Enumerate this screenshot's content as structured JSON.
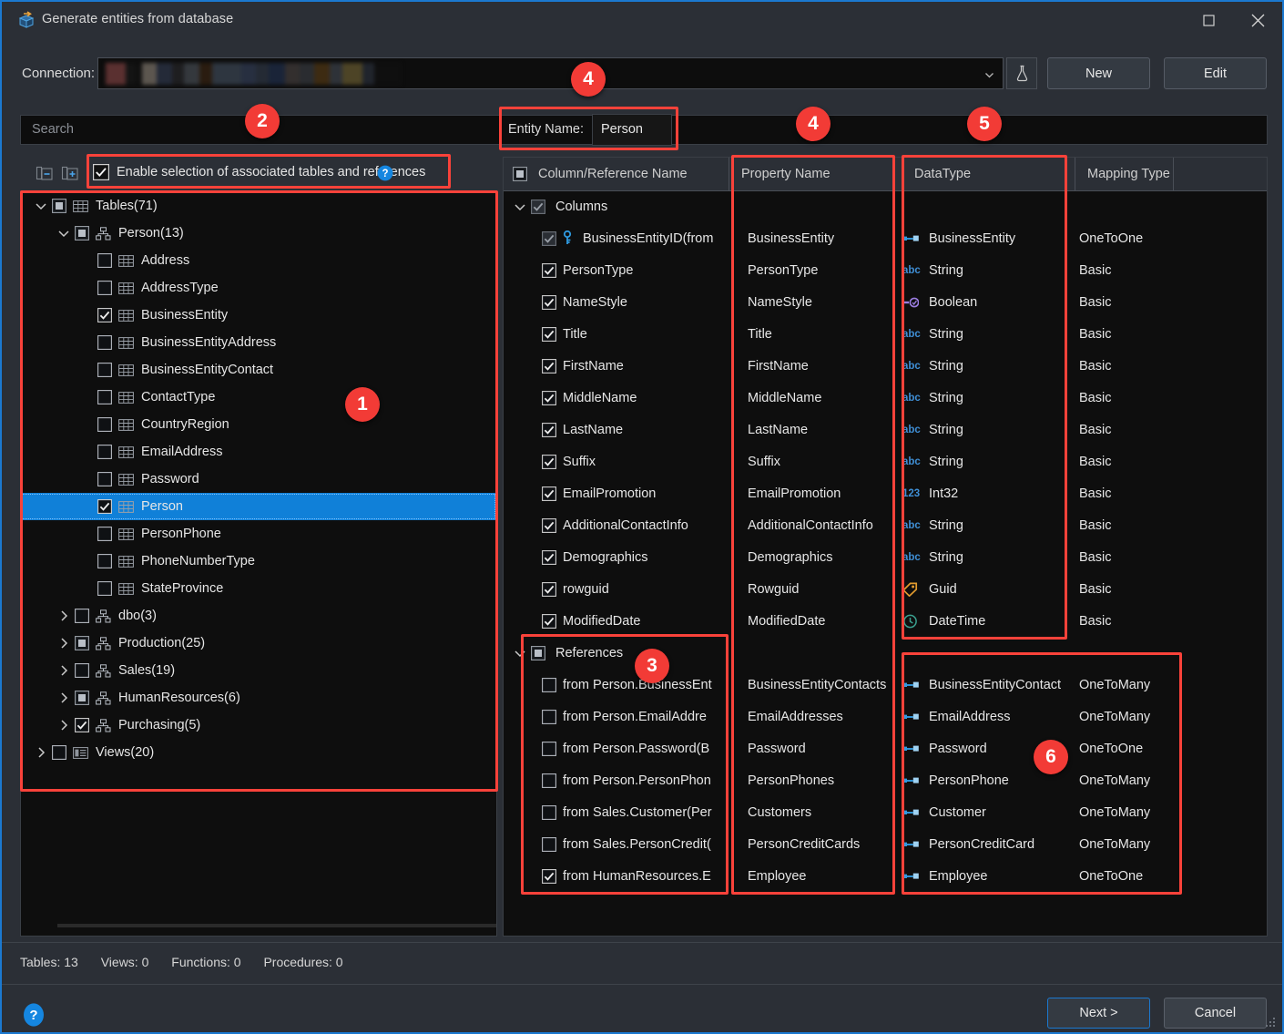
{
  "window": {
    "title": "Generate entities from database",
    "title_icon": "generate-entities-icon",
    "maximize_icon": "maximize-icon",
    "close_icon": "close-icon",
    "accent": "#1b79d0"
  },
  "connection": {
    "label": "Connection:",
    "value": "",
    "dropdown_icon": "chevron-down-icon",
    "test_icon": "flask-icon",
    "new_label": "New",
    "edit_label": "Edit"
  },
  "search": {
    "placeholder": "Search",
    "value": ""
  },
  "entity": {
    "label": "Entity Name:",
    "value": "Person"
  },
  "left_toolbar": {
    "collapse_icon": "collapse-all-icon",
    "expand_icon": "expand-all-icon",
    "assoc_label": "Enable selection of associated tables and references",
    "assoc_checked": true,
    "help_icon": "help-icon"
  },
  "tree": [
    {
      "label": "Tables(71)",
      "indent": 0,
      "chevron": "down",
      "check": "partial",
      "icon": "table-icon",
      "selected": false
    },
    {
      "label": "Person(13)",
      "indent": 1,
      "chevron": "down",
      "check": "partial",
      "icon": "schema-icon",
      "selected": false
    },
    {
      "label": "Address",
      "indent": 2,
      "chevron": "none",
      "check": "off",
      "icon": "table-icon",
      "selected": false
    },
    {
      "label": "AddressType",
      "indent": 2,
      "chevron": "none",
      "check": "off",
      "icon": "table-icon",
      "selected": false
    },
    {
      "label": "BusinessEntity",
      "indent": 2,
      "chevron": "none",
      "check": "on",
      "icon": "table-icon",
      "selected": false
    },
    {
      "label": "BusinessEntityAddress",
      "indent": 2,
      "chevron": "none",
      "check": "off",
      "icon": "table-icon",
      "selected": false
    },
    {
      "label": "BusinessEntityContact",
      "indent": 2,
      "chevron": "none",
      "check": "off",
      "icon": "table-icon",
      "selected": false
    },
    {
      "label": "ContactType",
      "indent": 2,
      "chevron": "none",
      "check": "off",
      "icon": "table-icon",
      "selected": false
    },
    {
      "label": "CountryRegion",
      "indent": 2,
      "chevron": "none",
      "check": "off",
      "icon": "table-icon",
      "selected": false
    },
    {
      "label": "EmailAddress",
      "indent": 2,
      "chevron": "none",
      "check": "off",
      "icon": "table-icon",
      "selected": false
    },
    {
      "label": "Password",
      "indent": 2,
      "chevron": "none",
      "check": "off",
      "icon": "table-icon",
      "selected": false
    },
    {
      "label": "Person",
      "indent": 2,
      "chevron": "none",
      "check": "on",
      "icon": "table-icon",
      "selected": true
    },
    {
      "label": "PersonPhone",
      "indent": 2,
      "chevron": "none",
      "check": "off",
      "icon": "table-icon",
      "selected": false
    },
    {
      "label": "PhoneNumberType",
      "indent": 2,
      "chevron": "none",
      "check": "off",
      "icon": "table-icon",
      "selected": false
    },
    {
      "label": "StateProvince",
      "indent": 2,
      "chevron": "none",
      "check": "off",
      "icon": "table-icon",
      "selected": false
    },
    {
      "label": "dbo(3)",
      "indent": 1,
      "chevron": "right",
      "check": "off",
      "icon": "schema-icon",
      "selected": false
    },
    {
      "label": "Production(25)",
      "indent": 1,
      "chevron": "right",
      "check": "partial",
      "icon": "schema-icon",
      "selected": false
    },
    {
      "label": "Sales(19)",
      "indent": 1,
      "chevron": "right",
      "check": "off",
      "icon": "schema-icon",
      "selected": false
    },
    {
      "label": "HumanResources(6)",
      "indent": 1,
      "chevron": "right",
      "check": "partial",
      "icon": "schema-icon",
      "selected": false
    },
    {
      "label": "Purchasing(5)",
      "indent": 1,
      "chevron": "right",
      "check": "on",
      "icon": "schema-icon",
      "selected": false
    },
    {
      "label": "Views(20)",
      "indent": 0,
      "chevron": "right",
      "check": "off",
      "icon": "view-icon",
      "selected": false
    }
  ],
  "grid": {
    "headers": {
      "column_name": "Column/Reference Name",
      "property_name": "Property Name",
      "data_type": "DataType",
      "mapping_type": "Mapping Type",
      "blank": ""
    },
    "header_check": "partial",
    "groups": [
      {
        "label": "Columns",
        "chevron": "down",
        "check": "on-disabled",
        "rows": [
          {
            "name": "BusinessEntityID(from",
            "check": "on-disabled",
            "row_icon": "primary-key-icon",
            "property": "BusinessEntity",
            "type": "BusinessEntity",
            "type_icon": "relation-icon",
            "mapping": "OneToOne"
          },
          {
            "name": "PersonType",
            "check": "on",
            "row_icon": "",
            "property": "PersonType",
            "type": "String",
            "type_icon": "abc-icon",
            "mapping": "Basic"
          },
          {
            "name": "NameStyle",
            "check": "on",
            "row_icon": "",
            "property": "NameStyle",
            "type": "Boolean",
            "type_icon": "boolean-icon",
            "mapping": "Basic"
          },
          {
            "name": "Title",
            "check": "on",
            "row_icon": "",
            "property": "Title",
            "type": "String",
            "type_icon": "abc-icon",
            "mapping": "Basic"
          },
          {
            "name": "FirstName",
            "check": "on",
            "row_icon": "",
            "property": "FirstName",
            "type": "String",
            "type_icon": "abc-icon",
            "mapping": "Basic"
          },
          {
            "name": "MiddleName",
            "check": "on",
            "row_icon": "",
            "property": "MiddleName",
            "type": "String",
            "type_icon": "abc-icon",
            "mapping": "Basic"
          },
          {
            "name": "LastName",
            "check": "on",
            "row_icon": "",
            "property": "LastName",
            "type": "String",
            "type_icon": "abc-icon",
            "mapping": "Basic"
          },
          {
            "name": "Suffix",
            "check": "on",
            "row_icon": "",
            "property": "Suffix",
            "type": "String",
            "type_icon": "abc-icon",
            "mapping": "Basic"
          },
          {
            "name": "EmailPromotion",
            "check": "on",
            "row_icon": "",
            "property": "EmailPromotion",
            "type": "Int32",
            "type_icon": "number-icon",
            "mapping": "Basic"
          },
          {
            "name": "AdditionalContactInfo",
            "check": "on",
            "row_icon": "",
            "property": "AdditionalContactInfo",
            "type": "String",
            "type_icon": "abc-icon",
            "mapping": "Basic"
          },
          {
            "name": "Demographics",
            "check": "on",
            "row_icon": "",
            "property": "Demographics",
            "type": "String",
            "type_icon": "abc-icon",
            "mapping": "Basic"
          },
          {
            "name": "rowguid",
            "check": "on",
            "row_icon": "",
            "property": "Rowguid",
            "type": "Guid",
            "type_icon": "guid-icon",
            "mapping": "Basic"
          },
          {
            "name": "ModifiedDate",
            "check": "on",
            "row_icon": "",
            "property": "ModifiedDate",
            "type": "DateTime",
            "type_icon": "datetime-icon",
            "mapping": "Basic"
          }
        ]
      },
      {
        "label": "References",
        "chevron": "down",
        "check": "partial",
        "rows": [
          {
            "name": "from Person.BusinessEnt",
            "check": "off",
            "row_icon": "",
            "property": "BusinessEntityContacts",
            "type": "BusinessEntityContact",
            "type_icon": "relation-icon",
            "mapping": "OneToMany"
          },
          {
            "name": "from Person.EmailAddre",
            "check": "off",
            "row_icon": "",
            "property": "EmailAddresses",
            "type": "EmailAddress",
            "type_icon": "relation-icon",
            "mapping": "OneToMany"
          },
          {
            "name": "from Person.Password(B",
            "check": "off",
            "row_icon": "",
            "property": "Password",
            "type": "Password",
            "type_icon": "relation-icon",
            "mapping": "OneToOne"
          },
          {
            "name": "from Person.PersonPhon",
            "check": "off",
            "row_icon": "",
            "property": "PersonPhones",
            "type": "PersonPhone",
            "type_icon": "relation-icon",
            "mapping": "OneToMany"
          },
          {
            "name": "from Sales.Customer(Per",
            "check": "off",
            "row_icon": "",
            "property": "Customers",
            "type": "Customer",
            "type_icon": "relation-icon",
            "mapping": "OneToMany"
          },
          {
            "name": "from Sales.PersonCredit(",
            "check": "off",
            "row_icon": "",
            "property": "PersonCreditCards",
            "type": "PersonCreditCard",
            "type_icon": "relation-icon",
            "mapping": "OneToMany"
          },
          {
            "name": "from HumanResources.E",
            "check": "on",
            "row_icon": "",
            "property": "Employee",
            "type": "Employee",
            "type_icon": "relation-icon",
            "mapping": "OneToOne"
          }
        ]
      }
    ]
  },
  "status": {
    "tables": "Tables: 13",
    "views": "Views: 0",
    "functions": "Functions: 0",
    "procedures": "Procedures: 0"
  },
  "footer": {
    "help_icon": "help-icon",
    "next_label": "Next >",
    "cancel_label": "Cancel",
    "resize_grip": "resize-grip-icon"
  },
  "annotations": [
    {
      "num": "1"
    },
    {
      "num": "2"
    },
    {
      "num": "3"
    },
    {
      "num": "4"
    },
    {
      "num": "4"
    },
    {
      "num": "5"
    },
    {
      "num": "6"
    }
  ]
}
